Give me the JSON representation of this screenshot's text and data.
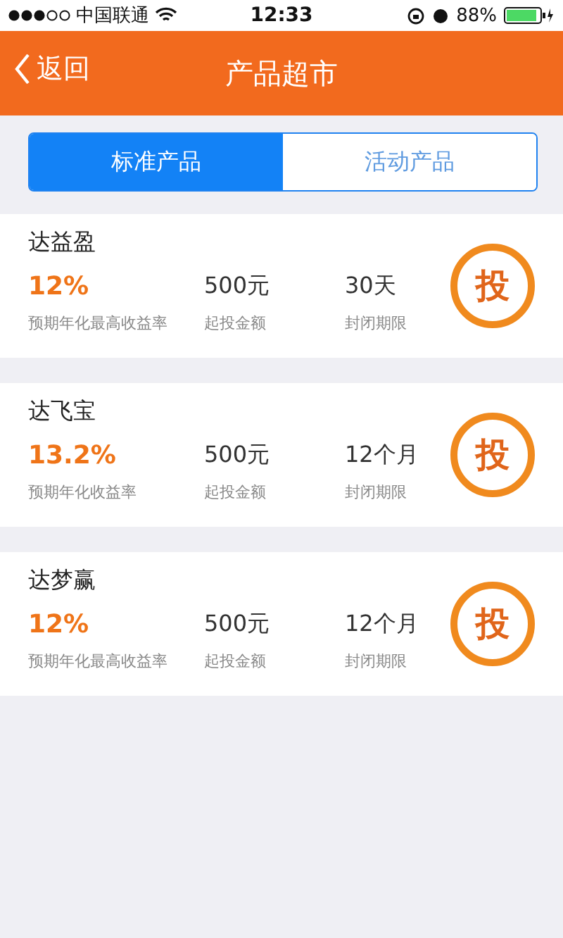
{
  "status_bar": {
    "carrier": "中国联通",
    "time": "12:33",
    "battery": "88%"
  },
  "nav": {
    "back": "返回",
    "title": "产品超市"
  },
  "tabs": [
    {
      "label": "标准产品",
      "selected": true
    },
    {
      "label": "活动产品",
      "selected": false
    }
  ],
  "products": [
    {
      "name": "达益盈",
      "rate": "12%",
      "rate_label": "预期年化最高收益率",
      "amount": "500元",
      "amount_label": "起投金额",
      "term": "30天",
      "term_label": "封闭期限",
      "action": "投"
    },
    {
      "name": "达飞宝",
      "rate": "13.2%",
      "rate_label": "预期年化收益率",
      "amount": "500元",
      "amount_label": "起投金额",
      "term": "12个月",
      "term_label": "封闭期限",
      "action": "投"
    },
    {
      "name": "达梦赢",
      "rate": "12%",
      "rate_label": "预期年化最高收益率",
      "amount": "500元",
      "amount_label": "起投金额",
      "term": "12个月",
      "term_label": "封闭期限",
      "action": "投"
    }
  ]
}
